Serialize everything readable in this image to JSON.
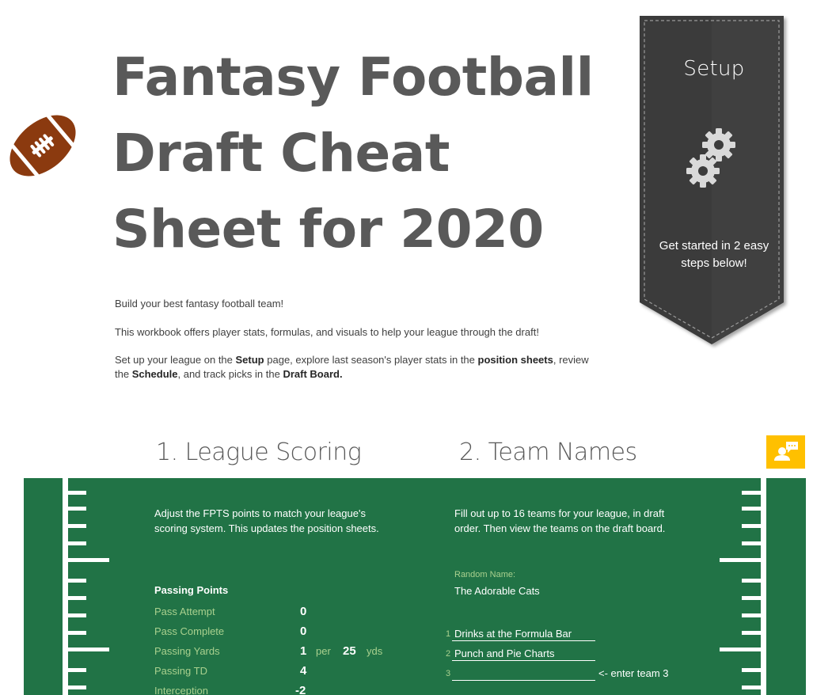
{
  "header": {
    "title_lines": [
      "Fantasy Football",
      "Draft Cheat",
      "Sheet for 2020"
    ],
    "logo_icon": "football-icon"
  },
  "intro": {
    "line1": "Build your best fantasy football team!",
    "line2": "This workbook offers player stats, formulas, and visuals to help your league through the draft!",
    "line3_parts": {
      "a": "Set up your league on the ",
      "b": "Setup",
      "c": " page, explore last season's player stats in the ",
      "d": "position sheets",
      "e": ", review the ",
      "f": "Schedule",
      "g": ", and track picks in the ",
      "h": "Draft Board",
      "i": "."
    }
  },
  "ribbon": {
    "title": "Setup",
    "icon": "gears-icon",
    "text": "Get started in 2 easy steps below!"
  },
  "comment_button": {
    "icon": "comment-person-icon",
    "color": "#ffc000"
  },
  "sections": {
    "scoring": {
      "heading": "1. League Scoring",
      "description": "Adjust the FPTS points to match your league's scoring system. This updates the position sheets.",
      "group_title": "Passing Points",
      "rows": [
        {
          "label": "Pass Attempt",
          "value": "0"
        },
        {
          "label": "Pass Complete",
          "value": "0"
        },
        {
          "label": "Passing Yards",
          "value": "1",
          "per_label": "per",
          "per_value": "25",
          "unit": "yds"
        },
        {
          "label": "Passing TD",
          "value": "4"
        },
        {
          "label": "Interception",
          "value": "-2"
        }
      ]
    },
    "teams": {
      "heading": "2. Team Names",
      "description": "Fill out up to 16 teams for your league, in draft order. Then view the teams on the draft board.",
      "random_label": "Random Name:",
      "random_value": "The Adorable Cats",
      "entries": [
        {
          "num": "1",
          "name": "Drinks at the Formula Bar",
          "hint": ""
        },
        {
          "num": "2",
          "name": "Punch and Pie Charts",
          "hint": ""
        },
        {
          "num": "3",
          "name": "",
          "hint": "<- enter team 3"
        }
      ]
    }
  },
  "colors": {
    "field_green": "#217346",
    "label_green": "#a9d08e",
    "ribbon_dark": "#3b3b3b",
    "football_brown": "#8b3a0f",
    "title_gray": "#595959"
  }
}
